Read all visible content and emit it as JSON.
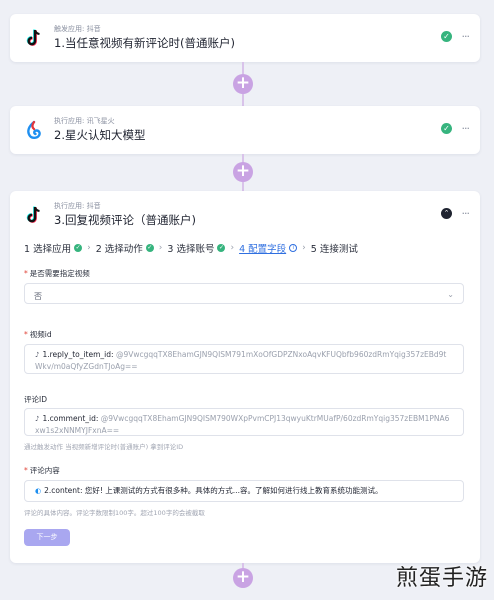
{
  "nodes": [
    {
      "sub": "触发应用: 抖音",
      "title": "1.当任意视频有新评论时(普通账户)",
      "icon": "tiktok-icon"
    },
    {
      "sub": "执行应用: 讯飞星火",
      "title": "2.星火认知大模型",
      "icon": "spark-icon"
    },
    {
      "sub": "执行应用: 抖音",
      "title": "3.回复视频评论（普通账户)",
      "icon": "tiktok-icon"
    }
  ],
  "more_label": "···",
  "connector_label": "+",
  "steps": [
    {
      "label": "1 选择应用",
      "done": true
    },
    {
      "label": "2 选择动作",
      "done": true
    },
    {
      "label": "3 选择账号",
      "done": true
    },
    {
      "label": "4 配置字段",
      "active": true
    },
    {
      "label": "5 连接测试"
    }
  ],
  "form": {
    "field1": {
      "label": "是否需要指定视频",
      "value": "否"
    },
    "field2": {
      "label": "视频id",
      "chip_name": "1.reply_to_item_id:",
      "chip_token": "@9VwcgqqTX8EhamGJN9QISM791mXoOfGDPZNxoAqvKFUQbfb960zdRmYqig357zEBd9tWkv/m0aQfyZGdnTJoAg=="
    },
    "field3": {
      "label": "评论ID",
      "chip_name": "1.comment_id:",
      "chip_token": "@9VwcgqqTX8EhamGJN9QISM790WXpPvmCPJ13qwyuKtrMUafP/60zdRmYqig357zEBM1PNA6xw1s2xNNMYJFxnA==",
      "hint": "通过触发动作 当视频新增评论时(普通账户) 拿到评论ID"
    },
    "field4": {
      "label": "评论内容",
      "chip_name": "2.content:",
      "chip_text": "您好! 上课测试的方式有很多种。具体的方式...容。了解如何进行线上教育系统功能测试。",
      "hint": "评论的具体内容。评论字数限制100字。超过100字的会被截取"
    },
    "next_label": "下一步"
  },
  "watermark": "煎蛋手游",
  "colors": {
    "accent": "#2f6fe0",
    "success": "#36b47e",
    "connector": "#c9a3e3",
    "button": "#a9a7f0",
    "required": "#e0453a"
  }
}
